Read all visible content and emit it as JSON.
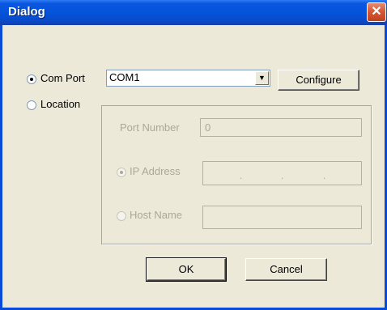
{
  "window": {
    "title": "Dialog",
    "close_glyph": "✕"
  },
  "connection": {
    "com_port_label": "Com Port",
    "com_port_value": "COM1",
    "configure_label": "Configure",
    "location_label": "Location",
    "selected": "com_port"
  },
  "location": {
    "port_number_label": "Port Number",
    "port_number_value": "0",
    "ip_address_label": "IP Address",
    "ip_address_dots": [
      ".",
      ".",
      "."
    ],
    "host_name_label": "Host Name",
    "host_name_value": "",
    "selected": "ip_address",
    "enabled": false
  },
  "buttons": {
    "ok_label": "OK",
    "cancel_label": "Cancel"
  },
  "icons": {
    "combo_arrow": "▼"
  },
  "colors": {
    "titlebar": "#0453d8",
    "dialog_bg": "#ece9d8",
    "close_button": "#d45a37"
  }
}
